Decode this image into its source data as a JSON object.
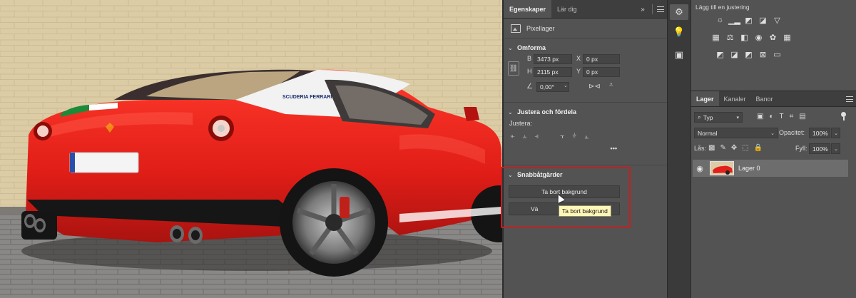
{
  "properties_panel": {
    "tabs": [
      {
        "label": "Egenskaper"
      },
      {
        "label": "Lär dig"
      }
    ],
    "collapse_icon": "double-chevron-right-icon",
    "layer_kind": "Pixellager",
    "transform": {
      "title": "Omforma",
      "width_label": "B",
      "width_value": "3473 px",
      "height_label": "H",
      "height_value": "2115 px",
      "x_label": "X",
      "x_value": "0 px",
      "y_label": "Y",
      "y_value": "0 px",
      "angle_value": "0,00°"
    },
    "align": {
      "title": "Justera och fördela",
      "subtitle": "Justera:",
      "more": "•••"
    },
    "quick_actions": {
      "title": "Snabbåtgärder",
      "remove_bg_label": "Ta bort bakgrund",
      "second_button_label": "Vä",
      "tooltip": "Ta bort bakgrund"
    }
  },
  "adjustments_panel": {
    "title": "Lägg till en justering"
  },
  "layers_panel": {
    "tabs": [
      {
        "label": "Lager"
      },
      {
        "label": "Kanaler"
      },
      {
        "label": "Banor"
      }
    ],
    "filter_kind": "Typ",
    "blend_mode": "Normal",
    "opacity_label": "Opacitet:",
    "opacity_value": "100%",
    "lock_label": "Lås:",
    "fill_label": "Fyll:",
    "fill_value": "100%",
    "layers": [
      {
        "name": "Lager 0",
        "visible": true
      }
    ]
  },
  "canvas": {
    "plate_text": "",
    "decal_text": "SCUDERIA FERRARI"
  },
  "colors": {
    "highlight": "#c81e1e",
    "car_red": "#e3201b",
    "tooltip_bg": "#fff7b8"
  }
}
